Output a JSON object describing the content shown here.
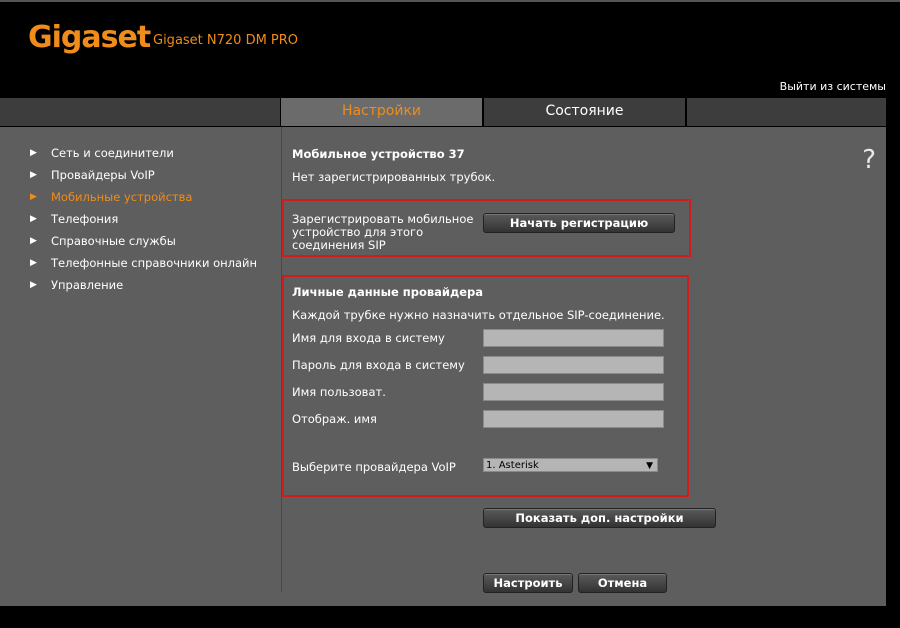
{
  "header": {
    "logo": "Gigaset",
    "model": "Gigaset N720 DM PRO",
    "logout": "Выйти из системы"
  },
  "tabs": [
    {
      "label": "Настройки",
      "active": true
    },
    {
      "label": "Состояние",
      "active": false
    }
  ],
  "sidebar": {
    "items": [
      {
        "label": "Сеть и соединители"
      },
      {
        "label": "Провайдеры VoIP"
      },
      {
        "label": "Мобильные устройства",
        "active": true
      },
      {
        "label": "Телефония"
      },
      {
        "label": "Справочные службы"
      },
      {
        "label": "Телефонные справочники онлайн"
      },
      {
        "label": "Управление"
      }
    ]
  },
  "main": {
    "title": "Мобильное устройство 37",
    "no_handsets": "Нет зарегистрированных трубок.",
    "register": {
      "label": "Зарегистрировать мобильное устройство для этого соединения SIP",
      "button": "Начать регистрацию"
    },
    "provider": {
      "heading": "Личные данные провайдера",
      "note": "Каждой трубке нужно назначить отдельное SIP-соединение.",
      "fields": [
        {
          "label": "Имя для входа в систему",
          "value": ""
        },
        {
          "label": "Пароль для входа в систему",
          "value": ""
        },
        {
          "label": "Имя пользоват.",
          "value": ""
        },
        {
          "label": "Отображ. имя",
          "value": ""
        }
      ],
      "voip_label": "Выберите провайдера VoIP",
      "voip_selected": "1. Asterisk"
    },
    "advanced_button": "Показать доп. настройки",
    "apply_button": "Настроить",
    "cancel_button": "Отмена",
    "help_icon": "?"
  },
  "colors": {
    "accent": "#f08c1a",
    "highlight_box": "#d01c1c",
    "panel": "#5e5e5e"
  }
}
